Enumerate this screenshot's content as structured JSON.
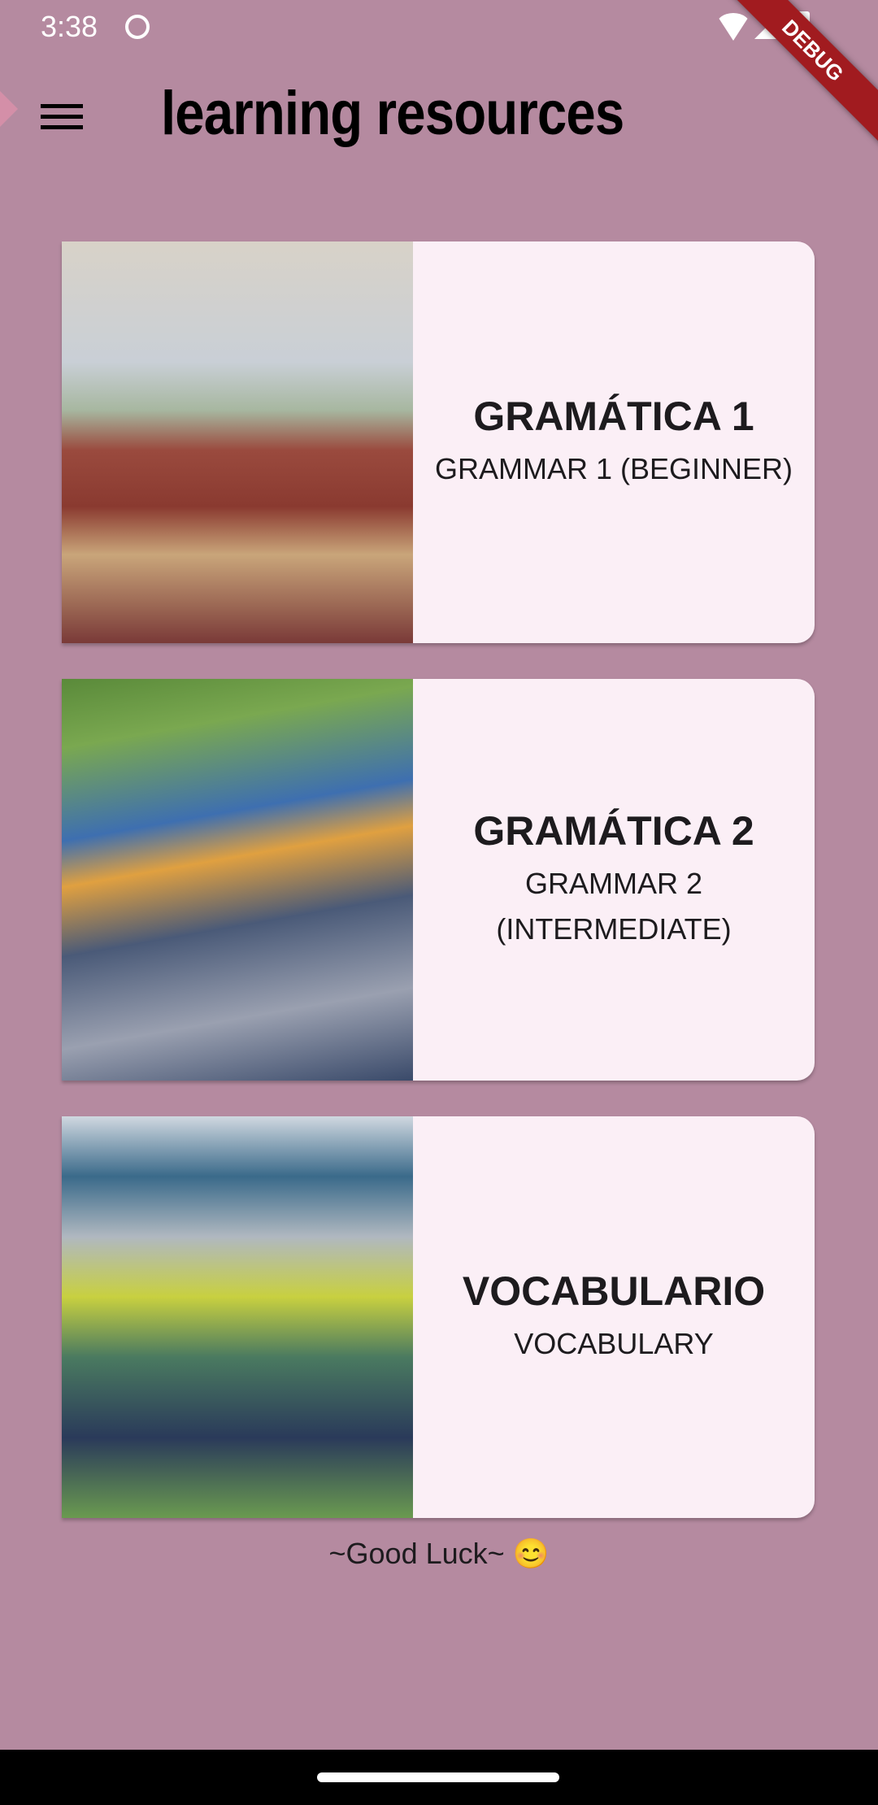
{
  "status_bar": {
    "time": "3:38",
    "icons": [
      "face-icon",
      "wifi-icon",
      "signal-icon",
      "battery-icon"
    ]
  },
  "debug_banner": "DEBUG",
  "app_bar": {
    "title": "learning resources",
    "menu_icon": "hamburger-menu-icon"
  },
  "cards": [
    {
      "title": "GRAMÁTICA 1",
      "subtitle": "GRAMMAR 1 (BEGINNER)",
      "image": "living-room-photo"
    },
    {
      "title": "GRAMÁTICA 2",
      "subtitle": "GRAMMAR 2 (INTERMEDIATE)",
      "image": "playground-photo"
    },
    {
      "title": "VOCABULARIO",
      "subtitle": "VOCABULARY",
      "image": "classroom-photo"
    }
  ],
  "footer": {
    "text": "~Good Luck~ 😊"
  },
  "colors": {
    "background": "#b58aa0",
    "card": "#fbeff6",
    "debug": "#a11b1f"
  }
}
